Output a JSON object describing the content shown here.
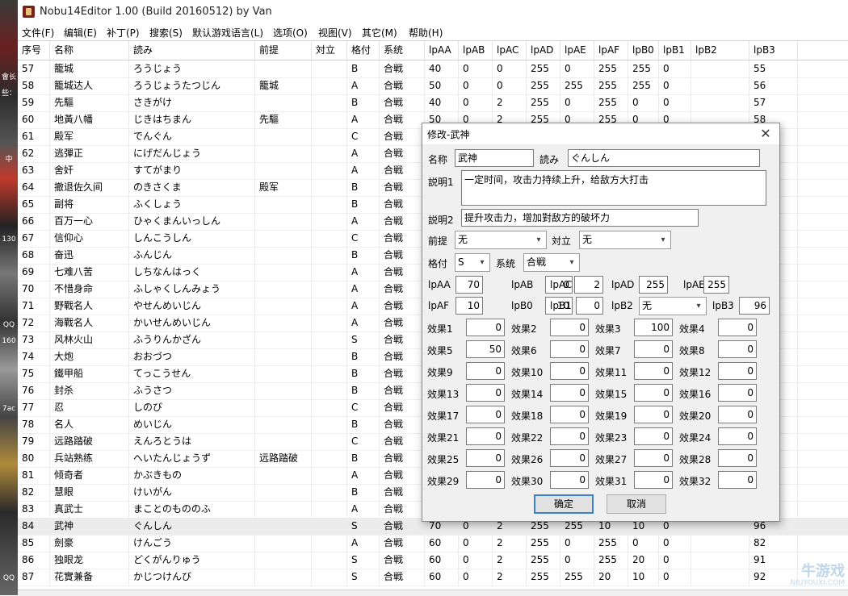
{
  "window": {
    "title": "Nobu14Editor 1.00 (Build 20160512) by Van"
  },
  "desktop_strip": {
    "ticks": [
      "會长",
      "些：",
      "中",
      "130",
      "QQ",
      "160",
      "7ac",
      "QQ"
    ]
  },
  "menu": [
    "文件(F)",
    "编辑(E)",
    "补丁(P)",
    "搜索(S)",
    "默认游戏语言(L)",
    "选项(O)",
    "视图(V)",
    "其它(M)",
    "帮助(H)"
  ],
  "table": {
    "headers": [
      "序号",
      "名称",
      "読み",
      "前提",
      "対立",
      "格付",
      "系统",
      "lpAA",
      "lpAB",
      "lpAC",
      "lpAD",
      "lpAE",
      "lpAF",
      "lpB0",
      "lpB1",
      "lpB2",
      "lpB3"
    ],
    "rows": [
      [
        "57",
        "籠城",
        "ろうじょう",
        "",
        "",
        "B",
        "合戦",
        "40",
        "0",
        "0",
        "255",
        "0",
        "255",
        "255",
        "0",
        "",
        "55"
      ],
      [
        "58",
        "籠城达人",
        "ろうじょうたつじん",
        "籠城",
        "",
        "A",
        "合戦",
        "50",
        "0",
        "0",
        "255",
        "255",
        "255",
        "255",
        "0",
        "",
        "56"
      ],
      [
        "59",
        "先驅",
        "さきがけ",
        "",
        "",
        "B",
        "合戦",
        "40",
        "0",
        "2",
        "255",
        "0",
        "255",
        "0",
        "0",
        "",
        "57"
      ],
      [
        "60",
        "地黃八幡",
        "じきはちまん",
        "先驅",
        "",
        "A",
        "合戦",
        "50",
        "0",
        "2",
        "255",
        "0",
        "255",
        "0",
        "0",
        "",
        "58"
      ],
      [
        "61",
        "殿军",
        "でんぐん",
        "",
        "",
        "C",
        "合戦",
        "",
        "",
        "",
        "",
        "",
        "",
        "",
        "",
        "",
        ""
      ],
      [
        "62",
        "逃彈正",
        "にげだんじょう",
        "",
        "",
        "A",
        "合戦",
        "",
        "",
        "",
        "",
        "",
        "",
        "",
        "",
        "",
        ""
      ],
      [
        "63",
        "舍奸",
        "すてがまり",
        "",
        "",
        "A",
        "合戦",
        "",
        "",
        "",
        "",
        "",
        "",
        "",
        "",
        "",
        ""
      ],
      [
        "64",
        "撤退佐久间",
        "のきさくま",
        "殿军",
        "",
        "B",
        "合戦",
        "",
        "",
        "",
        "",
        "",
        "",
        "",
        "",
        "",
        ""
      ],
      [
        "65",
        "副将",
        "ふくしょう",
        "",
        "",
        "B",
        "合戦",
        "",
        "",
        "",
        "",
        "",
        "",
        "",
        "",
        "",
        ""
      ],
      [
        "66",
        "百万一心",
        "ひゃくまんいっしん",
        "",
        "",
        "A",
        "合戦",
        "",
        "",
        "",
        "",
        "",
        "",
        "",
        "",
        "",
        ""
      ],
      [
        "67",
        "信仰心",
        "しんこうしん",
        "",
        "",
        "C",
        "合戦",
        "",
        "",
        "",
        "",
        "",
        "",
        "",
        "",
        "",
        ""
      ],
      [
        "68",
        "奋迅",
        "ふんじん",
        "",
        "",
        "B",
        "合戦",
        "",
        "",
        "",
        "",
        "",
        "",
        "",
        "",
        "",
        ""
      ],
      [
        "69",
        "七难八苦",
        "しちなんはっく",
        "",
        "",
        "A",
        "合戦",
        "",
        "",
        "",
        "",
        "",
        "",
        "",
        "",
        "",
        ""
      ],
      [
        "70",
        "不惜身命",
        "ふしゃくしんみょう",
        "",
        "",
        "A",
        "合戦",
        "",
        "",
        "",
        "",
        "",
        "",
        "",
        "",
        "",
        ""
      ],
      [
        "71",
        "野戰名人",
        "やせんめいじん",
        "",
        "",
        "A",
        "合戦",
        "",
        "",
        "",
        "",
        "",
        "",
        "",
        "",
        "",
        ""
      ],
      [
        "72",
        "海戰名人",
        "かいせんめいじん",
        "",
        "",
        "A",
        "合戦",
        "",
        "",
        "",
        "",
        "",
        "",
        "",
        "",
        "",
        ""
      ],
      [
        "73",
        "风林火山",
        "ふうりんかざん",
        "",
        "",
        "S",
        "合戦",
        "",
        "",
        "",
        "",
        "",
        "",
        "",
        "",
        "",
        ""
      ],
      [
        "74",
        "大炮",
        "おおづつ",
        "",
        "",
        "B",
        "合戦",
        "",
        "",
        "",
        "",
        "",
        "",
        "",
        "",
        "",
        ""
      ],
      [
        "75",
        "鐵甲船",
        "てっこうせん",
        "",
        "",
        "B",
        "合戦",
        "",
        "",
        "",
        "",
        "",
        "",
        "",
        "",
        "",
        ""
      ],
      [
        "76",
        "封杀",
        "ふうさつ",
        "",
        "",
        "B",
        "合戦",
        "",
        "",
        "",
        "",
        "",
        "",
        "",
        "",
        "",
        ""
      ],
      [
        "77",
        "忍",
        "しのび",
        "",
        "",
        "C",
        "合戦",
        "",
        "",
        "",
        "",
        "",
        "",
        "",
        "",
        "",
        ""
      ],
      [
        "78",
        "名人",
        "めいじん",
        "",
        "",
        "B",
        "合戦",
        "",
        "",
        "",
        "",
        "",
        "",
        "",
        "",
        "",
        ""
      ],
      [
        "79",
        "远路踏破",
        "えんろとうは",
        "",
        "",
        "C",
        "合戦",
        "",
        "",
        "",
        "",
        "",
        "",
        "",
        "",
        "",
        ""
      ],
      [
        "80",
        "兵站熟练",
        "へいたんじょうず",
        "远路踏破",
        "",
        "B",
        "合戦",
        "",
        "",
        "",
        "",
        "",
        "",
        "",
        "",
        "",
        ""
      ],
      [
        "81",
        "倾奇者",
        "かぶきもの",
        "",
        "",
        "A",
        "合戦",
        "",
        "",
        "",
        "",
        "",
        "",
        "",
        "",
        "",
        ""
      ],
      [
        "82",
        "慧眼",
        "けいがん",
        "",
        "",
        "B",
        "合戦",
        "",
        "",
        "",
        "",
        "",
        "",
        "",
        "",
        "",
        ""
      ],
      [
        "83",
        "真武士",
        "まことのもののふ",
        "",
        "",
        "A",
        "合戦",
        "",
        "",
        "",
        "",
        "",
        "",
        "",
        "",
        "",
        ""
      ],
      [
        "84",
        "武神",
        "ぐんしん",
        "",
        "",
        "S",
        "合戦",
        "70",
        "0",
        "2",
        "255",
        "255",
        "10",
        "10",
        "0",
        "",
        "96"
      ],
      [
        "85",
        "劍豪",
        "けんごう",
        "",
        "",
        "A",
        "合戦",
        "60",
        "0",
        "2",
        "255",
        "0",
        "255",
        "0",
        "0",
        "",
        "82"
      ],
      [
        "86",
        "独眼龙",
        "どくがんりゅう",
        "",
        "",
        "S",
        "合戦",
        "60",
        "0",
        "2",
        "255",
        "0",
        "255",
        "20",
        "0",
        "",
        "91"
      ],
      [
        "87",
        "花實兼备",
        "かじつけんび",
        "",
        "",
        "S",
        "合戦",
        "60",
        "0",
        "2",
        "255",
        "255",
        "20",
        "10",
        "0",
        "",
        "92"
      ]
    ],
    "selected_row": "84"
  },
  "dialog": {
    "title": "修改-武神",
    "name_label": "名称",
    "name_value": "武神",
    "reading_label": "読み",
    "reading_value": "ぐんしん",
    "desc1_label": "説明1",
    "desc1_value": "一定时间，攻击力持续上升，给敌方大打击",
    "desc2_label": "説明2",
    "desc2_value": "提升攻击力，增加對敌方的破坏力",
    "prereq_label": "前提",
    "prereq_value": "无",
    "oppose_label": "対立",
    "oppose_value": "无",
    "rank_label": "格付",
    "rank_value": "S",
    "system_label": "系统",
    "system_value": "合戦",
    "params": [
      {
        "label": "lpAA",
        "value": "70"
      },
      {
        "label": "lpAB",
        "value": "0"
      },
      {
        "label": "lpAC",
        "value": "2"
      },
      {
        "label": "lpAD",
        "value": "255"
      },
      {
        "label": "lpAE",
        "value": "255"
      },
      {
        "label": "lpAF",
        "value": "10"
      },
      {
        "label": "lpB0",
        "value": "10"
      },
      {
        "label": "lpB1",
        "value": "0"
      },
      {
        "label": "lpB2",
        "value": "无"
      },
      {
        "label": "lpB3",
        "value": "96"
      }
    ],
    "effects": [
      {
        "label": "效果1",
        "value": "0"
      },
      {
        "label": "效果2",
        "value": "0"
      },
      {
        "label": "效果3",
        "value": "100"
      },
      {
        "label": "效果4",
        "value": "0"
      },
      {
        "label": "效果5",
        "value": "50"
      },
      {
        "label": "效果6",
        "value": "0"
      },
      {
        "label": "效果7",
        "value": "0"
      },
      {
        "label": "效果8",
        "value": "0"
      },
      {
        "label": "效果9",
        "value": "0"
      },
      {
        "label": "效果10",
        "value": "0"
      },
      {
        "label": "效果11",
        "value": "0"
      },
      {
        "label": "效果12",
        "value": "0"
      },
      {
        "label": "效果13",
        "value": "0"
      },
      {
        "label": "效果14",
        "value": "0"
      },
      {
        "label": "效果15",
        "value": "0"
      },
      {
        "label": "效果16",
        "value": "0"
      },
      {
        "label": "效果17",
        "value": "0"
      },
      {
        "label": "效果18",
        "value": "0"
      },
      {
        "label": "效果19",
        "value": "0"
      },
      {
        "label": "效果20",
        "value": "0"
      },
      {
        "label": "效果21",
        "value": "0"
      },
      {
        "label": "效果22",
        "value": "0"
      },
      {
        "label": "效果23",
        "value": "0"
      },
      {
        "label": "效果24",
        "value": "0"
      },
      {
        "label": "效果25",
        "value": "0"
      },
      {
        "label": "效果26",
        "value": "0"
      },
      {
        "label": "效果27",
        "value": "0"
      },
      {
        "label": "效果28",
        "value": "0"
      },
      {
        "label": "效果29",
        "value": "0"
      },
      {
        "label": "效果30",
        "value": "0"
      },
      {
        "label": "效果31",
        "value": "0"
      },
      {
        "label": "效果32",
        "value": "0"
      }
    ],
    "ok_label": "确定",
    "cancel_label": "取消"
  },
  "watermark": {
    "text": "牛游戏",
    "subtext": "NIUYOUXI.COM"
  }
}
